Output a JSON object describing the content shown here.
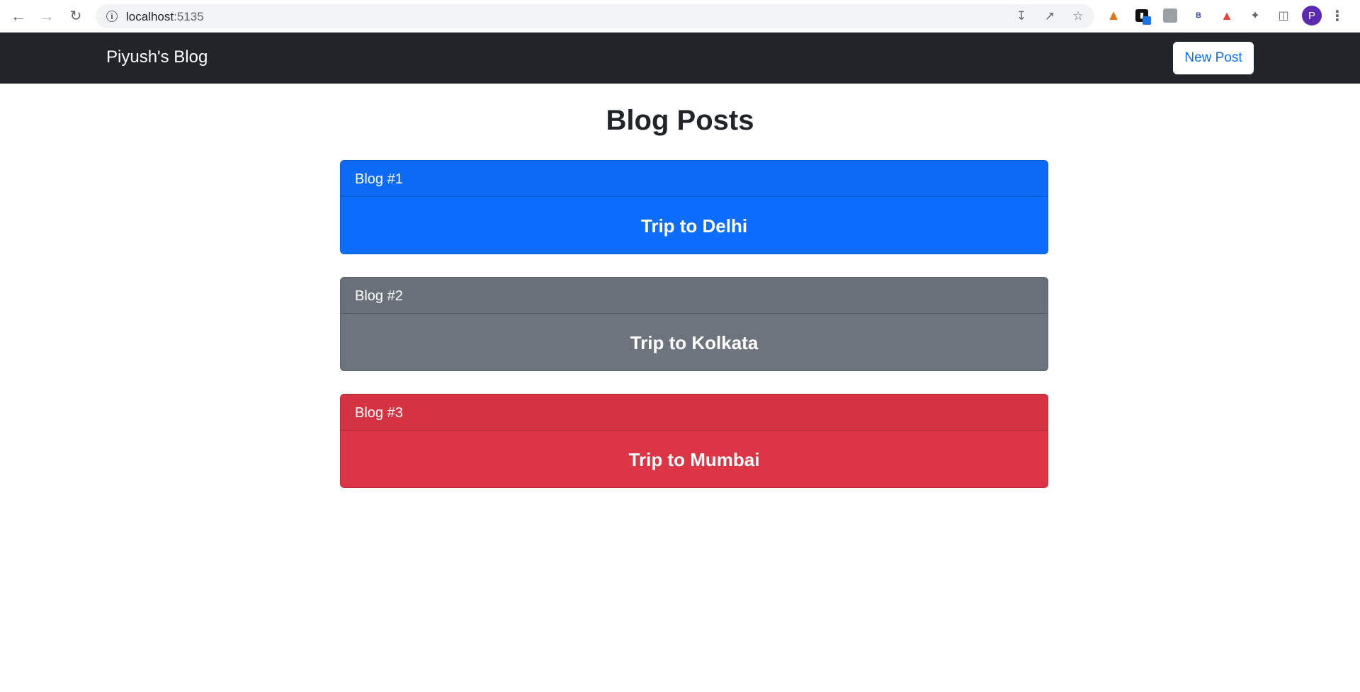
{
  "browser": {
    "back_icon": "arrow-left",
    "forward_icon": "arrow-right",
    "reload_icon": "reload",
    "url_host": "localhost",
    "url_port": ":5135",
    "avatar_letter": "P"
  },
  "navbar": {
    "brand": "Piyush's Blog",
    "new_post_label": "New Post"
  },
  "main": {
    "title": "Blog Posts",
    "posts": [
      {
        "header": "Blog #1",
        "title": "Trip to Delhi",
        "color": "#0d6efd"
      },
      {
        "header": "Blog #2",
        "title": "Trip to Kolkata",
        "color": "#6c757d"
      },
      {
        "header": "Blog #3",
        "title": "Trip to Mumbai",
        "color": "#dc3545"
      }
    ]
  }
}
